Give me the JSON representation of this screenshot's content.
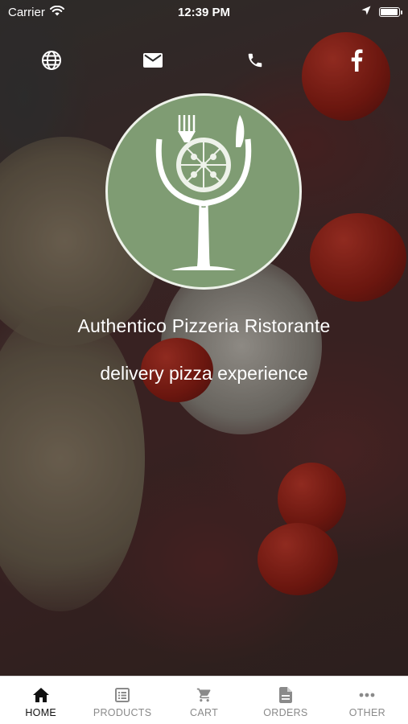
{
  "status_bar": {
    "carrier": "Carrier",
    "time": "12:39 PM",
    "battery_level": 0.95
  },
  "contact_icons": [
    {
      "name": "globe-icon"
    },
    {
      "name": "mail-icon"
    },
    {
      "name": "phone-icon"
    },
    {
      "name": "facebook-icon"
    }
  ],
  "restaurant": {
    "name": "Authentico Pizzeria Ristorante",
    "tagline": "delivery pizza experience"
  },
  "colors": {
    "logo_green": "#7f9c73",
    "tab_active": "#111111",
    "tab_inactive": "#8a8a8a"
  },
  "tabs": [
    {
      "label": "HOME",
      "icon": "home-icon",
      "active": true
    },
    {
      "label": "PRODUCTS",
      "icon": "list-icon",
      "active": false
    },
    {
      "label": "CART",
      "icon": "cart-icon",
      "active": false
    },
    {
      "label": "ORDERS",
      "icon": "document-icon",
      "active": false
    },
    {
      "label": "OTHER",
      "icon": "more-icon",
      "active": false
    }
  ]
}
